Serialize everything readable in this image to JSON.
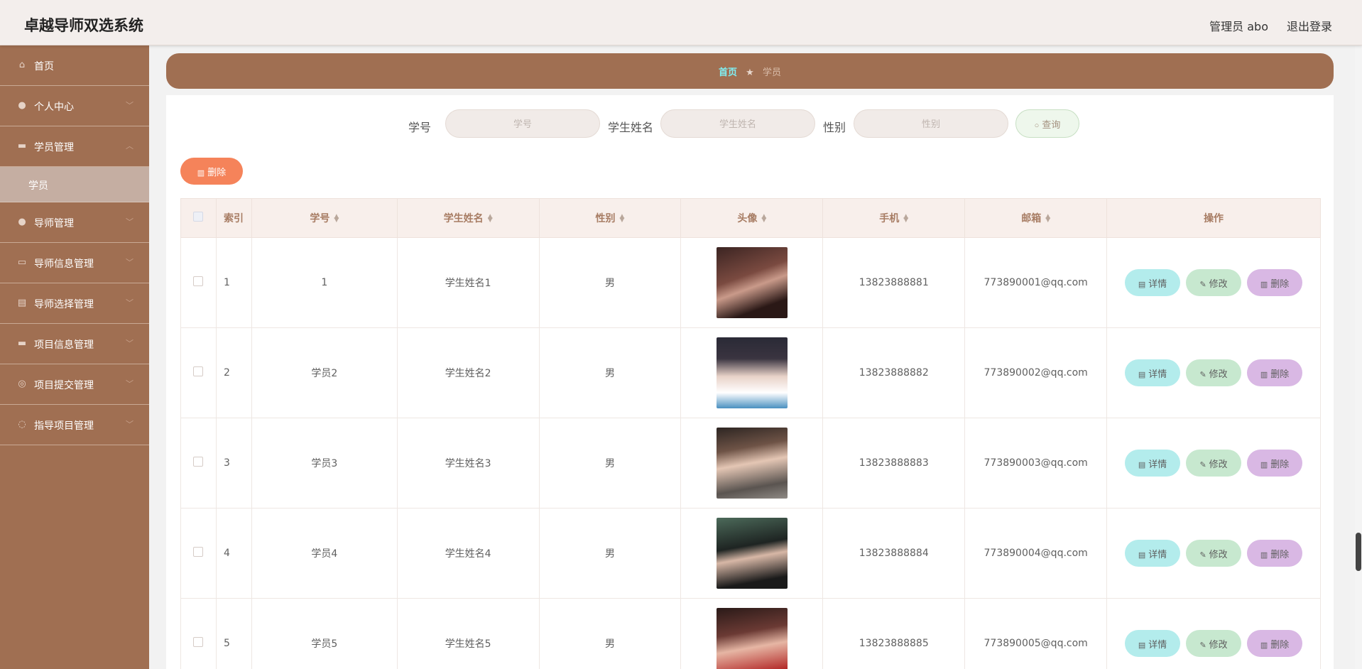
{
  "header": {
    "title": "卓越导师双选系统",
    "user": "管理员 abo",
    "logout": "退出登录"
  },
  "sidebar": {
    "items": [
      {
        "label": "首页",
        "icon": "home-icon"
      },
      {
        "label": "个人中心",
        "icon": "user-icon"
      },
      {
        "label": "学员管理",
        "icon": "briefcase-icon",
        "expanded": true
      },
      {
        "label": "导师管理",
        "icon": "location-icon"
      },
      {
        "label": "导师信息管理",
        "icon": "monitor-icon"
      },
      {
        "label": "导师选择管理",
        "icon": "clipboard-icon"
      },
      {
        "label": "项目信息管理",
        "icon": "wallet-icon"
      },
      {
        "label": "项目提交管理",
        "icon": "target-icon"
      },
      {
        "label": "指导项目管理",
        "icon": "loading-icon"
      }
    ],
    "sub_item": "学员"
  },
  "breadcrumb": {
    "home": "首页",
    "current": "学员"
  },
  "search": {
    "student_no_label": "学号",
    "student_no_placeholder": "学号",
    "name_label": "学生姓名",
    "name_placeholder": "学生姓名",
    "gender_label": "性别",
    "gender_placeholder": "性别",
    "query": "查询"
  },
  "toolbar": {
    "delete": "删除"
  },
  "table": {
    "headers": [
      "索引",
      "学号",
      "学生姓名",
      "性别",
      "头像",
      "手机",
      "邮箱",
      "操作"
    ],
    "actions": {
      "detail": "详情",
      "edit": "修改",
      "delete": "删除"
    },
    "rows": [
      {
        "index": "1",
        "student_no": "1",
        "name": "学生姓名1",
        "gender": "男",
        "phone": "13823888881",
        "email": "773890001@qq.com"
      },
      {
        "index": "2",
        "student_no": "学员2",
        "name": "学生姓名2",
        "gender": "男",
        "phone": "13823888882",
        "email": "773890002@qq.com"
      },
      {
        "index": "3",
        "student_no": "学员3",
        "name": "学生姓名3",
        "gender": "男",
        "phone": "13823888883",
        "email": "773890003@qq.com"
      },
      {
        "index": "4",
        "student_no": "学员4",
        "name": "学生姓名4",
        "gender": "男",
        "phone": "13823888884",
        "email": "773890004@qq.com"
      },
      {
        "index": "5",
        "student_no": "学员5",
        "name": "学生姓名5",
        "gender": "男",
        "phone": "13823888885",
        "email": "773890005@qq.com"
      }
    ]
  },
  "colors": {
    "brand": "#a06f52",
    "breadcrumb_home": "#7ff0f4",
    "delete_button": "#f5835a",
    "detail": "#b3ecec",
    "edit": "#c7e8cf",
    "remove": "#d9b8e4"
  }
}
